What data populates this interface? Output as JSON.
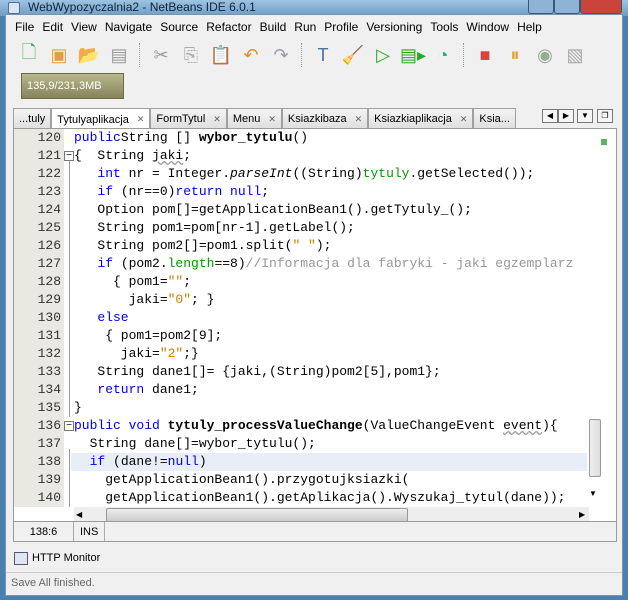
{
  "window": {
    "title": "WebWypozyczalnia2 - NetBeans IDE 6.0.1"
  },
  "menu": [
    "File",
    "Edit",
    "View",
    "Navigate",
    "Source",
    "Refactor",
    "Build",
    "Run",
    "Profile",
    "Versioning",
    "Tools",
    "Window",
    "Help"
  ],
  "toolbar": {
    "icons": [
      "new-file-icon",
      "new-project-icon",
      "open-project-icon",
      "close-project-icon",
      "cut-icon",
      "copy-icon",
      "paste-icon",
      "undo-icon",
      "redo-icon",
      "build-icon",
      "clean-build-icon",
      "run-icon",
      "debug-icon",
      "profile-icon",
      "stop-icon",
      "pause-icon",
      "continue-icon",
      "apply-code-changes-icon"
    ],
    "memory": "135,9/231,3MB"
  },
  "tabs": [
    {
      "label": "...tuly"
    },
    {
      "label": "Tytulyaplikacja",
      "active": true
    },
    {
      "label": "FormTytul"
    },
    {
      "label": "Menu"
    },
    {
      "label": "Ksiazkibaza"
    },
    {
      "label": "Ksiazkiaplikacja"
    },
    {
      "label": "Ksia..."
    }
  ],
  "editor": {
    "current_line": 138,
    "lines": [
      {
        "n": "120",
        "t": [
          [
            "kw",
            "public"
          ],
          [
            "",
            "String [] "
          ],
          [
            "b",
            "wybor_tytulu"
          ],
          [
            "",
            "()"
          ]
        ]
      },
      {
        "n": "121",
        "fold": true,
        "t": [
          [
            "",
            "{  String "
          ],
          [
            "sq",
            "jaki"
          ],
          [
            "",
            ";"
          ]
        ]
      },
      {
        "n": "122",
        "t": [
          [
            "",
            "   "
          ],
          [
            "kw",
            "int"
          ],
          [
            "",
            " nr = Integer."
          ],
          [
            "it",
            "parseInt"
          ],
          [
            "",
            "((String)"
          ],
          [
            "fld",
            "tytuly"
          ],
          [
            "",
            ".getSelected());"
          ]
        ]
      },
      {
        "n": "123",
        "t": [
          [
            "",
            "   "
          ],
          [
            "kw",
            "if"
          ],
          [
            "",
            " (nr==0)"
          ],
          [
            "kw",
            "return null"
          ],
          [
            "",
            ";"
          ]
        ]
      },
      {
        "n": "124",
        "t": [
          [
            "",
            "   Option pom[]=getApplicationBean1().getTytuly_();"
          ]
        ]
      },
      {
        "n": "125",
        "t": [
          [
            "",
            "   String pom1=pom[nr-1].getLabel();"
          ]
        ]
      },
      {
        "n": "126",
        "t": [
          [
            "",
            "   String pom2[]=pom1.split("
          ],
          [
            "str",
            "\" \""
          ],
          [
            "",
            ");"
          ]
        ]
      },
      {
        "n": "127",
        "t": [
          [
            "",
            "   "
          ],
          [
            "kw",
            "if"
          ],
          [
            "",
            " (pom2."
          ],
          [
            "fld",
            "length"
          ],
          [
            "",
            "==8)"
          ],
          [
            "cmt",
            "//Informacja dla fabryki - jaki egzemplarz"
          ]
        ]
      },
      {
        "n": "128",
        "t": [
          [
            "",
            "     { pom1="
          ],
          [
            "str",
            "\"\""
          ],
          [
            "",
            ";"
          ]
        ]
      },
      {
        "n": "129",
        "t": [
          [
            "",
            "       jaki="
          ],
          [
            "str",
            "\"0\""
          ],
          [
            "",
            "; }"
          ]
        ]
      },
      {
        "n": "130",
        "t": [
          [
            "",
            "   "
          ],
          [
            "kw",
            "else"
          ]
        ]
      },
      {
        "n": "131",
        "t": [
          [
            "",
            "    { pom1=pom2[9];"
          ]
        ]
      },
      {
        "n": "132",
        "t": [
          [
            "",
            "      jaki="
          ],
          [
            "str",
            "\"2\""
          ],
          [
            "",
            ";}"
          ]
        ]
      },
      {
        "n": "133",
        "t": [
          [
            "",
            "   String dane1[]= {jaki,(String)pom2[5],pom1};"
          ]
        ]
      },
      {
        "n": "134",
        "t": [
          [
            "",
            "   "
          ],
          [
            "kw",
            "return"
          ],
          [
            "",
            " dane1;"
          ]
        ]
      },
      {
        "n": "135",
        "end": true,
        "t": [
          [
            "",
            "}"
          ]
        ]
      },
      {
        "n": "136",
        "fold": true,
        "t": [
          [
            "kw",
            "public void "
          ],
          [
            "b",
            "tytuly_processValueChange"
          ],
          [
            "",
            "(ValueChangeEvent "
          ],
          [
            "sq",
            "event"
          ],
          [
            "",
            "){"
          ]
        ]
      },
      {
        "n": "137",
        "t": [
          [
            "",
            "  String dane[]=wybor_tytulu();"
          ]
        ]
      },
      {
        "n": "138",
        "t": [
          [
            "",
            "  "
          ],
          [
            "kw",
            "if"
          ],
          [
            "",
            " (dane!="
          ],
          [
            "kw",
            "null"
          ],
          [
            "",
            ")"
          ]
        ]
      },
      {
        "n": "139",
        "t": [
          [
            "",
            "    getApplicationBean1().przygotujksiazki("
          ]
        ]
      },
      {
        "n": "140",
        "t": [
          [
            "",
            "    getApplicationBean1().getAplikacja().Wyszukaj_tytul(dane));"
          ]
        ]
      }
    ]
  },
  "status": {
    "position": "138:6",
    "mode": "INS"
  },
  "panel": {
    "http_monitor": "HTTP Monitor"
  },
  "statusbar": {
    "message": "Save All finished."
  }
}
